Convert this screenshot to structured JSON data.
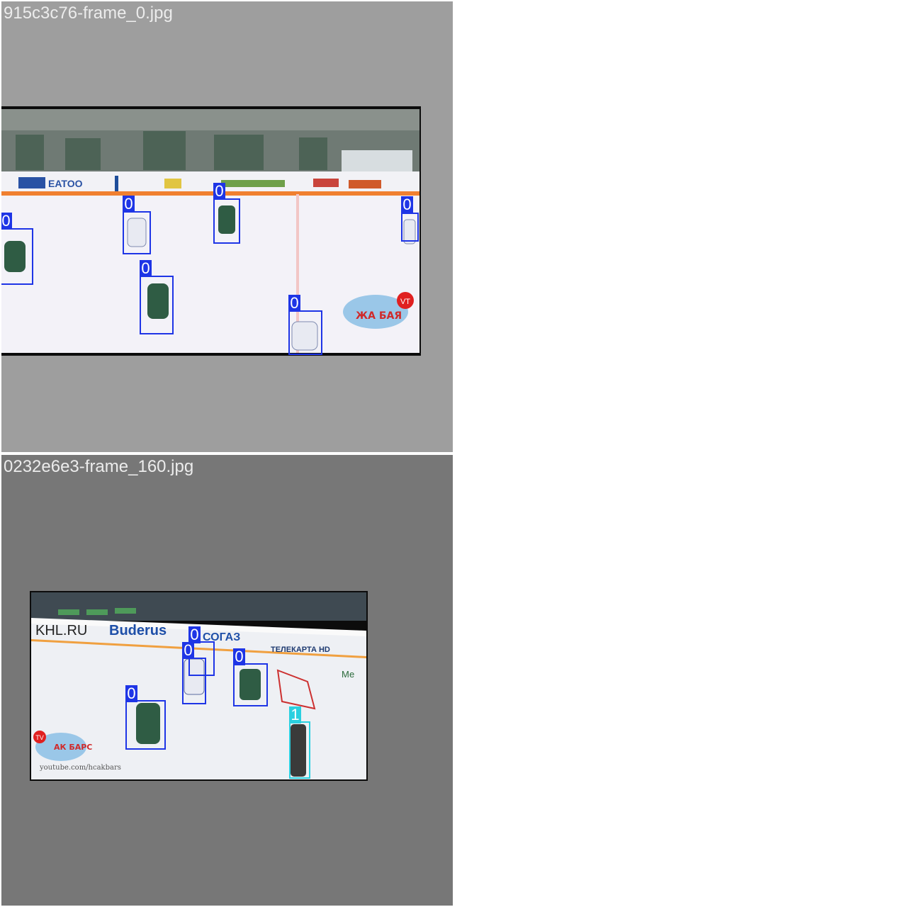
{
  "mosaic": {
    "tiles": [
      {
        "filename": "915c3c76-frame_0.jpg",
        "boards": [
          "EATOO"
        ],
        "detections": [
          {
            "label": "0",
            "class_color": "#1e35e6"
          },
          {
            "label": "0",
            "class_color": "#1e35e6"
          },
          {
            "label": "0",
            "class_color": "#1e35e6"
          },
          {
            "label": "0",
            "class_color": "#1e35e6"
          },
          {
            "label": "0",
            "class_color": "#1e35e6"
          },
          {
            "label": "0",
            "class_color": "#1e35e6"
          }
        ],
        "logo": {
          "badge": "VT",
          "lettering": "ЖА БАЯ"
        }
      },
      {
        "filename": "0232e6e3-frame_160.jpg",
        "boards": [
          "KHL.RU",
          "Buderus",
          "СОГАЗ",
          "ТЕЛЕКАРТА HD",
          "Ме"
        ],
        "detections": [
          {
            "label": "0",
            "class_color": "#1e35e6"
          },
          {
            "label": "0",
            "class_color": "#1e35e6"
          },
          {
            "label": "0",
            "class_color": "#1e35e6"
          },
          {
            "label": "0",
            "class_color": "#1e35e6"
          },
          {
            "label": "1",
            "class_color": "#2ad0e0"
          }
        ],
        "logo": {
          "badge": "TV",
          "lettering": "АК БАРС",
          "url": "youtube.com/hcakbars"
        }
      }
    ]
  }
}
